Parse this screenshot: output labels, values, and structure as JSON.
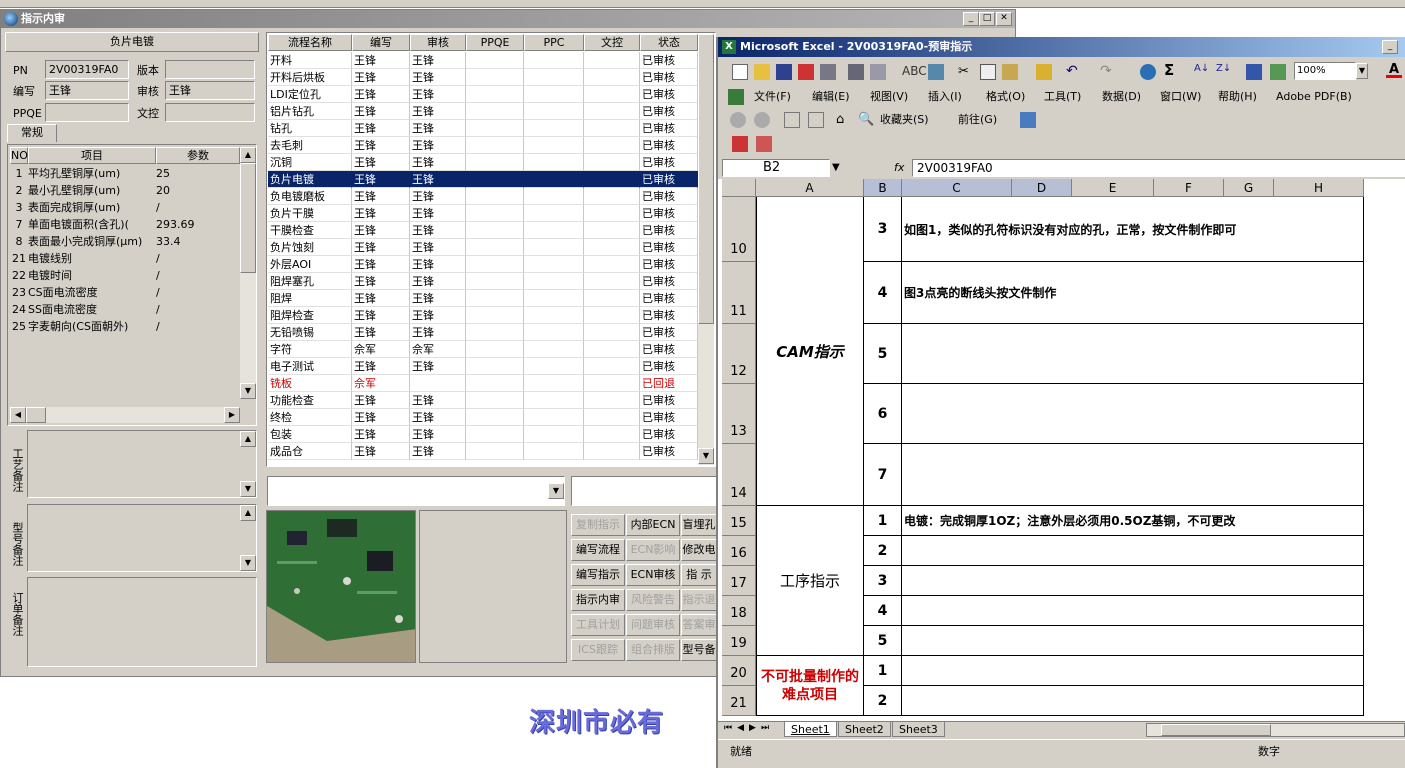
{
  "app": {
    "title": "指示内审",
    "left_panel": {
      "header": "负片电镀",
      "pn_label": "PN",
      "pn_value": "2V00319FA0",
      "version_label": "版本",
      "version_value": "",
      "writer_label": "编写",
      "writer_value": "王锋",
      "reviewer_label": "审核",
      "reviewer_value": "王锋",
      "ppqe_label": "PPQE",
      "ppqe_value": "",
      "wenkong_label": "文控",
      "wenkong_value": "",
      "tab_label": "常规",
      "param_headers": [
        "NO",
        "项目",
        "参数"
      ],
      "params": [
        {
          "no": "1",
          "item": "平均孔壁铜厚(um)",
          "val": "25"
        },
        {
          "no": "2",
          "item": "最小孔壁铜厚(um)",
          "val": "20"
        },
        {
          "no": "3",
          "item": "表面完成铜厚(um)",
          "val": "/"
        },
        {
          "no": "7",
          "item": "单面电镀面积(含孔)(",
          "val": "293.69"
        },
        {
          "no": "8",
          "item": "表面最小完成铜厚(μm)",
          "val": "33.4"
        },
        {
          "no": "21",
          "item": "电镀线别",
          "val": "/"
        },
        {
          "no": "22",
          "item": "电镀时间",
          "val": "/"
        },
        {
          "no": "23",
          "item": "CS面电流密度",
          "val": "/"
        },
        {
          "no": "24",
          "item": "SS面电流密度",
          "val": "/"
        },
        {
          "no": "25",
          "item": "字麦朝向(CS面朝外)",
          "val": "/"
        }
      ],
      "note_labels": [
        "工艺备注",
        "型号备注",
        "订单备注"
      ]
    },
    "process_table": {
      "headers": [
        "流程名称",
        "编写",
        "审核",
        "PPQE",
        "PPC",
        "文控",
        "状态"
      ],
      "rows": [
        {
          "name": "开料",
          "w": "王锋",
          "r": "王锋",
          "s": "已审核"
        },
        {
          "name": "开料后烘板",
          "w": "王锋",
          "r": "王锋",
          "s": "已审核"
        },
        {
          "name": "LDI定位孔",
          "w": "王锋",
          "r": "王锋",
          "s": "已审核"
        },
        {
          "name": "铝片钻孔",
          "w": "王锋",
          "r": "王锋",
          "s": "已审核"
        },
        {
          "name": "钻孔",
          "w": "王锋",
          "r": "王锋",
          "s": "已审核"
        },
        {
          "name": "去毛刺",
          "w": "王锋",
          "r": "王锋",
          "s": "已审核"
        },
        {
          "name": "沉铜",
          "w": "王锋",
          "r": "王锋",
          "s": "已审核"
        },
        {
          "name": "负片电镀",
          "w": "王锋",
          "r": "王锋",
          "s": "已审核"
        },
        {
          "name": "负电镀磨板",
          "w": "王锋",
          "r": "王锋",
          "s": "已审核"
        },
        {
          "name": "负片干膜",
          "w": "王锋",
          "r": "王锋",
          "s": "已审核"
        },
        {
          "name": "干膜检查",
          "w": "王锋",
          "r": "王锋",
          "s": "已审核"
        },
        {
          "name": "负片蚀刻",
          "w": "王锋",
          "r": "王锋",
          "s": "已审核"
        },
        {
          "name": "外层AOI",
          "w": "王锋",
          "r": "王锋",
          "s": "已审核"
        },
        {
          "name": "阻焊塞孔",
          "w": "王锋",
          "r": "王锋",
          "s": "已审核"
        },
        {
          "name": "阻焊",
          "w": "王锋",
          "r": "王锋",
          "s": "已审核"
        },
        {
          "name": "阻焊检查",
          "w": "王锋",
          "r": "王锋",
          "s": "已审核"
        },
        {
          "name": "无铅喷锡",
          "w": "王锋",
          "r": "王锋",
          "s": "已审核"
        },
        {
          "name": "字符",
          "w": "佘军",
          "r": "佘军",
          "s": "已审核"
        },
        {
          "name": "电子测试",
          "w": "王锋",
          "r": "王锋",
          "s": "已审核"
        },
        {
          "name": "铣板",
          "w": "佘军",
          "r": "",
          "s": "已回退"
        },
        {
          "name": "功能检查",
          "w": "王锋",
          "r": "王锋",
          "s": "已审核"
        },
        {
          "name": "终检",
          "w": "王锋",
          "r": "王锋",
          "s": "已审核"
        },
        {
          "name": "包装",
          "w": "王锋",
          "r": "王锋",
          "s": "已审核"
        },
        {
          "name": "成品仓",
          "w": "王锋",
          "r": "王锋",
          "s": "已审核"
        }
      ]
    },
    "buttons": [
      [
        "复制指示",
        "内部ECN",
        "盲埋孔"
      ],
      [
        "编写流程",
        "ECN影响",
        "修改电"
      ],
      [
        "编写指示",
        "ECN审核",
        "指 示"
      ],
      [
        "指示内审",
        "风险警告",
        "指示退"
      ],
      [
        "工具计划",
        "问题审核",
        "答案审"
      ],
      [
        "ICS跟踪",
        "组合排版",
        "型号备"
      ]
    ],
    "watermark": "深圳市必有"
  },
  "excel": {
    "title": "Microsoft Excel - 2V00319FA0-预审指示",
    "menus": [
      "文件(F)",
      "编辑(E)",
      "视图(V)",
      "插入(I)",
      "格式(O)",
      "工具(T)",
      "数据(D)",
      "窗口(W)",
      "帮助(H)",
      "Adobe PDF(B)"
    ],
    "zoom": "100%",
    "favorites": "收藏夹(S)",
    "goto": "前往(G)",
    "name_box": "B2",
    "fx": "fx",
    "formula": "2V00319FA0",
    "columns": [
      "A",
      "B",
      "C",
      "D",
      "E",
      "F",
      "G",
      "H"
    ],
    "rows": [
      "10",
      "11",
      "12",
      "13",
      "14",
      "15",
      "16",
      "17",
      "18",
      "19",
      "20",
      "21"
    ],
    "cam_label": "CAM指示",
    "cam_items": [
      {
        "n": "3",
        "text": "如图1，类似的孔符标识没有对应的孔，正常，按文件制作即可"
      },
      {
        "n": "4",
        "text": "图3点亮的断线头按文件制作"
      },
      {
        "n": "5",
        "text": ""
      },
      {
        "n": "6",
        "text": ""
      },
      {
        "n": "7",
        "text": ""
      }
    ],
    "proc_label": "工序指示",
    "proc_items": [
      {
        "n": "1",
        "text": "电镀：完成铜厚1OZ；注意外层必须用0.5OZ基铜，不可更改"
      },
      {
        "n": "2",
        "text": ""
      },
      {
        "n": "3",
        "text": ""
      },
      {
        "n": "4",
        "text": ""
      },
      {
        "n": "5",
        "text": ""
      }
    ],
    "hard_label": "不可批量制作的难点项目",
    "hard_items": [
      {
        "n": "1"
      },
      {
        "n": "2"
      }
    ],
    "sheets": [
      "Sheet1",
      "Sheet2",
      "Sheet3"
    ],
    "status_left": "就绪",
    "status_right": "数字",
    "colors": {
      "title_bar": "#0a246a",
      "red": "#cc0000",
      "selection": "#0a246a"
    }
  }
}
